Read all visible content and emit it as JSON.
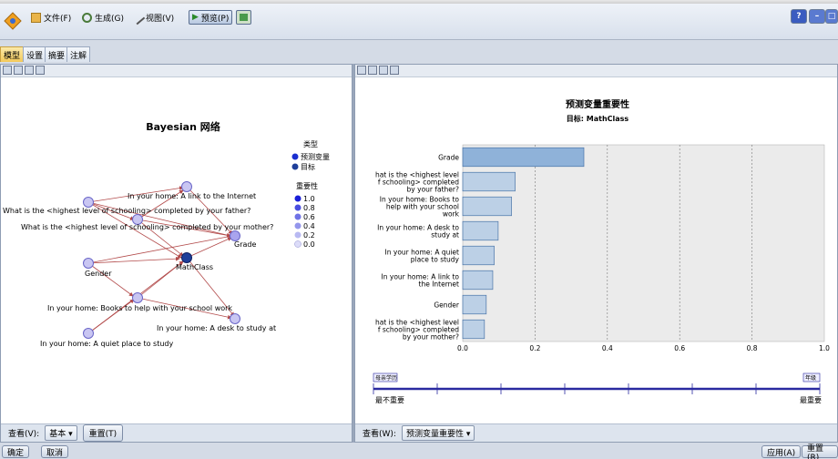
{
  "toolbar": {
    "file": "文件(F)",
    "generate": "生成(G)",
    "view": "视图(V)",
    "preview": "预览(P)",
    "help_icon": "question-icon",
    "min_icon": "minimize-icon",
    "close_icon": "close-icon"
  },
  "tabs": [
    "模型",
    "设置",
    "摘要",
    "注解"
  ],
  "network": {
    "title": "Bayesian 网络",
    "legend_type_title": "类型",
    "legend_predictor": "预测变量",
    "legend_target": "目标",
    "legend_importance_title": "重要性",
    "importance_levels": [
      "1.0",
      "0.8",
      "0.6",
      "0.4",
      "0.2",
      "0.0"
    ],
    "nodes": {
      "internet": "In your home: A link to the Internet",
      "father": "What is the <highest level of schooling> completed by your father?",
      "mother": "What is the <highest level of schooling> completed by your mother?",
      "grade": "Grade",
      "gender": "Gender",
      "mathclass": "MathClass",
      "books": "In your home: Books to help with your school work",
      "desk": "In your home: A desk to study at",
      "quiet": "In your home: A quiet place to study"
    }
  },
  "left_footer": {
    "view_label": "查看(V):",
    "view_value": "基本",
    "reset": "重置(T)"
  },
  "right_footer": {
    "view_label": "查看(W):",
    "view_value": "预测变量重要性"
  },
  "chart_data": {
    "type": "bar",
    "orientation": "horizontal",
    "title": "预测变量重要性",
    "subtitle": "目标: MathClass",
    "categories": [
      "Grade",
      "What is the <highest level of schooling> completed by your father?",
      "In your home: Books to help with your school work",
      "In your home: A desk to study at",
      "In your home: A quiet place to study",
      "In your home: A link to the Internet",
      "Gender",
      "What is the <highest level of schooling> completed by your mother?"
    ],
    "category_labels_visible": [
      [
        "Grade"
      ],
      [
        "hat is the <highest level",
        "f schooling> completed",
        "by your father?"
      ],
      [
        "In your home: Books to",
        "help with your school",
        "work"
      ],
      [
        "In your home: A desk to",
        "study at"
      ],
      [
        "In your home: A quiet",
        "place to study"
      ],
      [
        "In your home: A link to",
        "the Internet"
      ],
      [
        "Gender"
      ],
      [
        "hat is the <highest level",
        "f schooling> completed",
        "by your mother?"
      ]
    ],
    "values": [
      0.335,
      0.145,
      0.135,
      0.098,
      0.087,
      0.083,
      0.065,
      0.06
    ],
    "xlim": [
      0,
      1.0
    ],
    "xticks": [
      "0.0",
      "0.2",
      "0.4",
      "0.6",
      "0.8",
      "1.0"
    ],
    "grid": true,
    "bar_color": "#8fb2d9"
  },
  "slider": {
    "left_label": "母亲学历",
    "right_label": "年级",
    "min_text": "最不重要",
    "max_text": "最重要"
  },
  "bottom": {
    "ok": "确定",
    "cancel": "取消",
    "apply": "应用(A)",
    "reset": "重置(R)"
  },
  "colors": {
    "predictor": "#c9c6f2",
    "target": "#1f3f9a",
    "edge": "#b24a4a"
  }
}
